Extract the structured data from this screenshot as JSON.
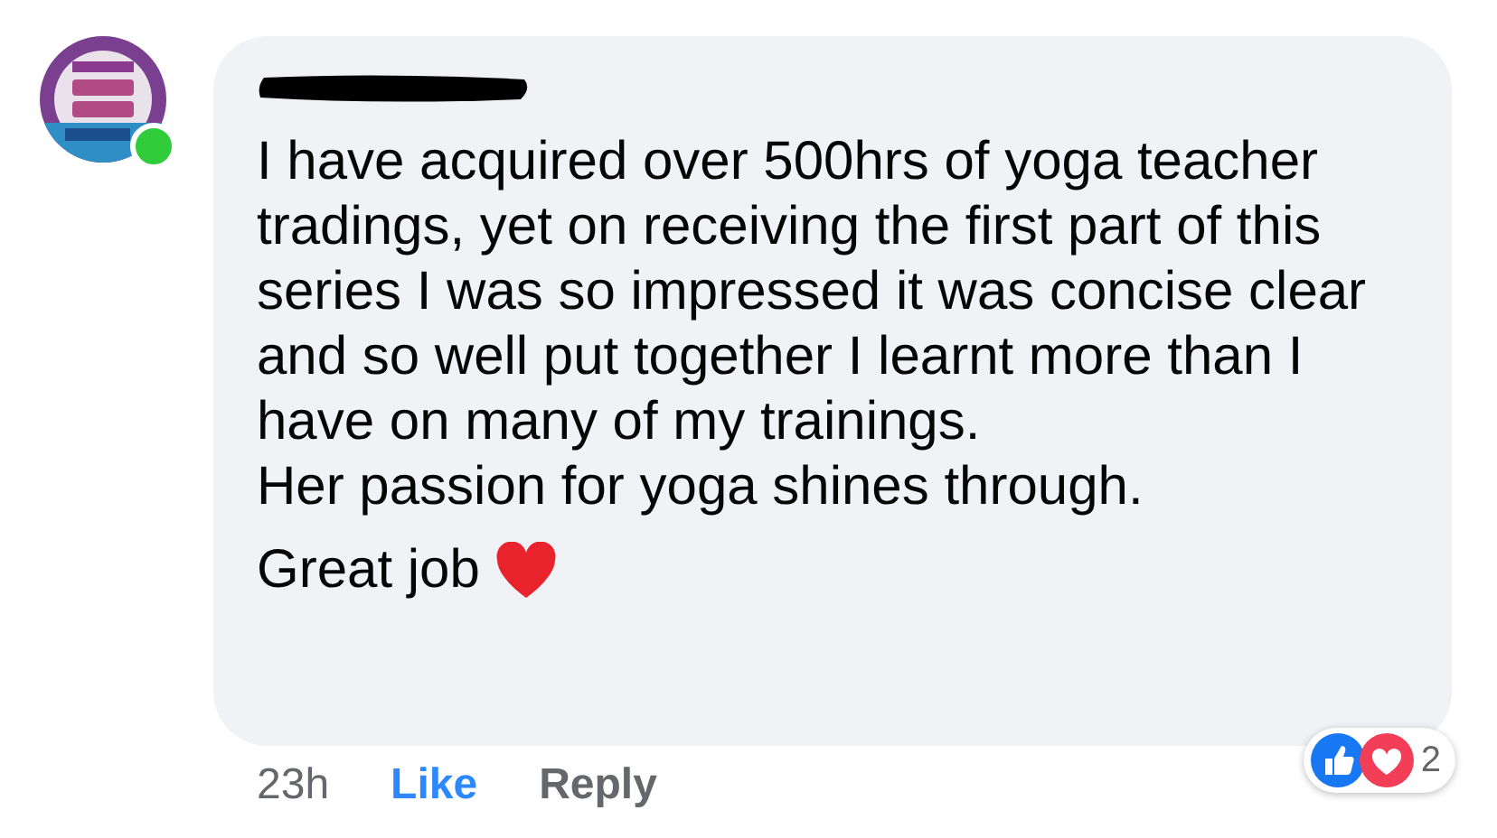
{
  "comment": {
    "author": {
      "online": true,
      "name_redacted": true
    },
    "paragraphs": [
      "I have acquired over 500hrs of yoga teacher tradings, yet on receiving the first part of this series I was so impressed it was concise clear and so well put together I learnt more than I have on many of my trainings.",
      "Her passion for yoga shines through."
    ],
    "closing": "Great job",
    "time": "23h",
    "actions": [
      {
        "label": "Like",
        "selected": true
      },
      {
        "label": "Reply",
        "selected": false
      }
    ],
    "reactions": {
      "items": [
        {
          "kind": "like"
        },
        {
          "kind": "love"
        }
      ],
      "count": "2"
    }
  }
}
